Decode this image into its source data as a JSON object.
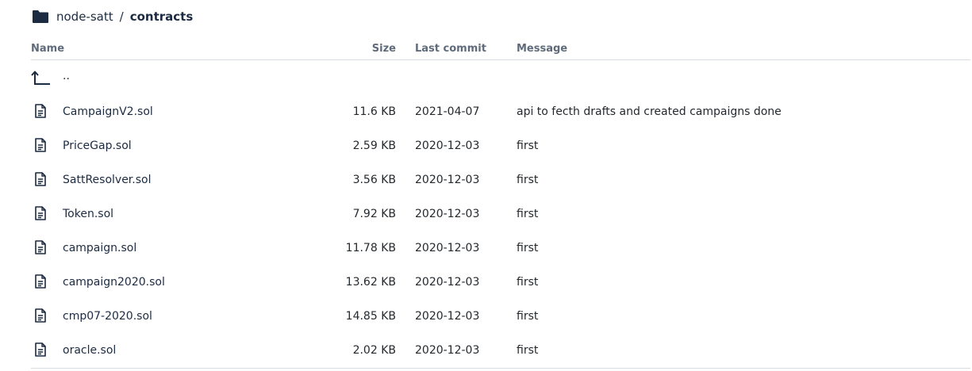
{
  "breadcrumb": {
    "repo": "node-satt",
    "separator": "/",
    "current": "contracts"
  },
  "table": {
    "headers": {
      "name": "Name",
      "size": "Size",
      "last_commit": "Last commit",
      "message": "Message"
    },
    "parent": "..",
    "rows": [
      {
        "name": "CampaignV2.sol",
        "size": "11.6 KB",
        "last_commit": "2021-04-07",
        "message": "api to fecth drafts and created campaigns done"
      },
      {
        "name": "PriceGap.sol",
        "size": "2.59 KB",
        "last_commit": "2020-12-03",
        "message": "first"
      },
      {
        "name": "SattResolver.sol",
        "size": "3.56 KB",
        "last_commit": "2020-12-03",
        "message": "first"
      },
      {
        "name": "Token.sol",
        "size": "7.92 KB",
        "last_commit": "2020-12-03",
        "message": "first"
      },
      {
        "name": "campaign.sol",
        "size": "11.78 KB",
        "last_commit": "2020-12-03",
        "message": "first"
      },
      {
        "name": "campaign2020.sol",
        "size": "13.62 KB",
        "last_commit": "2020-12-03",
        "message": "first"
      },
      {
        "name": "cmp07-2020.sol",
        "size": "14.85 KB",
        "last_commit": "2020-12-03",
        "message": "first"
      },
      {
        "name": "oracle.sol",
        "size": "2.02 KB",
        "last_commit": "2020-12-03",
        "message": "first"
      }
    ]
  },
  "icons": {
    "folder": "folder-icon",
    "parent": "parent-directory-icon",
    "file": "file-icon"
  },
  "colors": {
    "link": "#1c2b41",
    "header_text": "#5f6b7a",
    "border": "#d8dde3"
  }
}
